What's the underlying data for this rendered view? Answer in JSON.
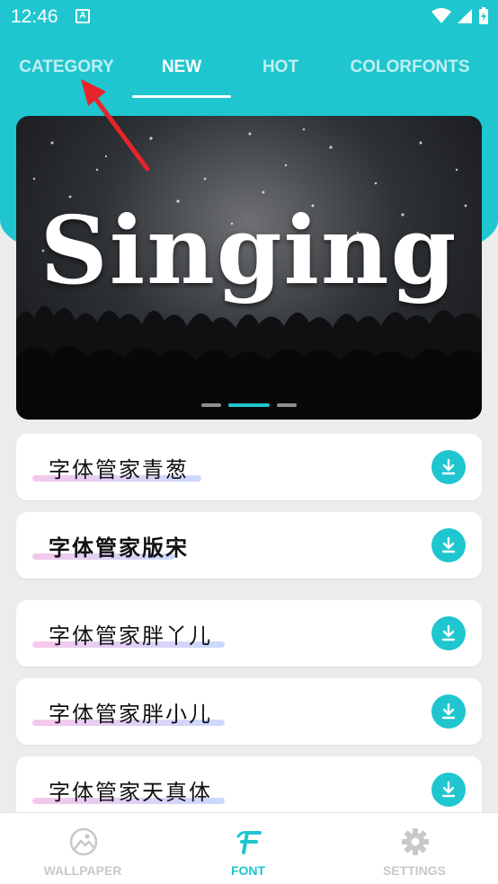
{
  "status": {
    "time": "12:46",
    "notif_letter": "A"
  },
  "tabs": [
    {
      "label": "CATEGORY"
    },
    {
      "label": "NEW"
    },
    {
      "label": "HOT"
    },
    {
      "label": "COLORFONTS"
    }
  ],
  "banner": {
    "title": "Singing"
  },
  "fonts": [
    {
      "name": "字体管家青葱"
    },
    {
      "name": "字体管家版宋"
    },
    {
      "name": "字体管家胖丫儿"
    },
    {
      "name": "字体管家胖小儿"
    },
    {
      "name": "字体管家天真体"
    }
  ],
  "bottom_nav": [
    {
      "label": "WALLPAPER",
      "icon": "wallpaper-icon"
    },
    {
      "label": "FONT",
      "icon": "font-icon"
    },
    {
      "label": "SETTINGS",
      "icon": "gear-icon"
    }
  ],
  "colors": {
    "accent": "#1fc6cf",
    "arrow": "#e8242b"
  }
}
